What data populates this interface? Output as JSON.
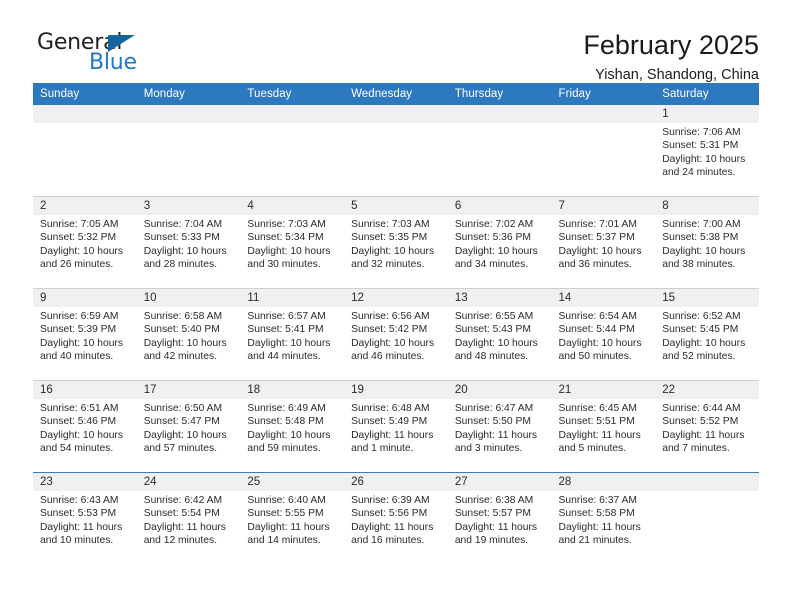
{
  "brand": {
    "name_top": "General",
    "name_bottom": "Blue",
    "accent_color": "#2179c4",
    "triangle_color": "#15659f"
  },
  "header": {
    "title": "February 2025",
    "subtitle": "Yishan, Shandong, China"
  },
  "calendar": {
    "header_bg": "#2c79c0",
    "daynum_bg": "#f0f0f0",
    "weekday_headers": [
      "Sunday",
      "Monday",
      "Tuesday",
      "Wednesday",
      "Thursday",
      "Friday",
      "Saturday"
    ],
    "weeks": [
      [
        {
          "day": "",
          "empty": true
        },
        {
          "day": "",
          "empty": true
        },
        {
          "day": "",
          "empty": true
        },
        {
          "day": "",
          "empty": true
        },
        {
          "day": "",
          "empty": true
        },
        {
          "day": "",
          "empty": true
        },
        {
          "day": "1",
          "sunrise": "Sunrise: 7:06 AM",
          "sunset": "Sunset: 5:31 PM",
          "daylight": "Daylight: 10 hours and 24 minutes."
        }
      ],
      [
        {
          "day": "2",
          "sunrise": "Sunrise: 7:05 AM",
          "sunset": "Sunset: 5:32 PM",
          "daylight": "Daylight: 10 hours and 26 minutes."
        },
        {
          "day": "3",
          "sunrise": "Sunrise: 7:04 AM",
          "sunset": "Sunset: 5:33 PM",
          "daylight": "Daylight: 10 hours and 28 minutes."
        },
        {
          "day": "4",
          "sunrise": "Sunrise: 7:03 AM",
          "sunset": "Sunset: 5:34 PM",
          "daylight": "Daylight: 10 hours and 30 minutes."
        },
        {
          "day": "5",
          "sunrise": "Sunrise: 7:03 AM",
          "sunset": "Sunset: 5:35 PM",
          "daylight": "Daylight: 10 hours and 32 minutes."
        },
        {
          "day": "6",
          "sunrise": "Sunrise: 7:02 AM",
          "sunset": "Sunset: 5:36 PM",
          "daylight": "Daylight: 10 hours and 34 minutes."
        },
        {
          "day": "7",
          "sunrise": "Sunrise: 7:01 AM",
          "sunset": "Sunset: 5:37 PM",
          "daylight": "Daylight: 10 hours and 36 minutes."
        },
        {
          "day": "8",
          "sunrise": "Sunrise: 7:00 AM",
          "sunset": "Sunset: 5:38 PM",
          "daylight": "Daylight: 10 hours and 38 minutes."
        }
      ],
      [
        {
          "day": "9",
          "sunrise": "Sunrise: 6:59 AM",
          "sunset": "Sunset: 5:39 PM",
          "daylight": "Daylight: 10 hours and 40 minutes."
        },
        {
          "day": "10",
          "sunrise": "Sunrise: 6:58 AM",
          "sunset": "Sunset: 5:40 PM",
          "daylight": "Daylight: 10 hours and 42 minutes."
        },
        {
          "day": "11",
          "sunrise": "Sunrise: 6:57 AM",
          "sunset": "Sunset: 5:41 PM",
          "daylight": "Daylight: 10 hours and 44 minutes."
        },
        {
          "day": "12",
          "sunrise": "Sunrise: 6:56 AM",
          "sunset": "Sunset: 5:42 PM",
          "daylight": "Daylight: 10 hours and 46 minutes."
        },
        {
          "day": "13",
          "sunrise": "Sunrise: 6:55 AM",
          "sunset": "Sunset: 5:43 PM",
          "daylight": "Daylight: 10 hours and 48 minutes."
        },
        {
          "day": "14",
          "sunrise": "Sunrise: 6:54 AM",
          "sunset": "Sunset: 5:44 PM",
          "daylight": "Daylight: 10 hours and 50 minutes."
        },
        {
          "day": "15",
          "sunrise": "Sunrise: 6:52 AM",
          "sunset": "Sunset: 5:45 PM",
          "daylight": "Daylight: 10 hours and 52 minutes."
        }
      ],
      [
        {
          "day": "16",
          "sunrise": "Sunrise: 6:51 AM",
          "sunset": "Sunset: 5:46 PM",
          "daylight": "Daylight: 10 hours and 54 minutes."
        },
        {
          "day": "17",
          "sunrise": "Sunrise: 6:50 AM",
          "sunset": "Sunset: 5:47 PM",
          "daylight": "Daylight: 10 hours and 57 minutes."
        },
        {
          "day": "18",
          "sunrise": "Sunrise: 6:49 AM",
          "sunset": "Sunset: 5:48 PM",
          "daylight": "Daylight: 10 hours and 59 minutes."
        },
        {
          "day": "19",
          "sunrise": "Sunrise: 6:48 AM",
          "sunset": "Sunset: 5:49 PM",
          "daylight": "Daylight: 11 hours and 1 minute."
        },
        {
          "day": "20",
          "sunrise": "Sunrise: 6:47 AM",
          "sunset": "Sunset: 5:50 PM",
          "daylight": "Daylight: 11 hours and 3 minutes."
        },
        {
          "day": "21",
          "sunrise": "Sunrise: 6:45 AM",
          "sunset": "Sunset: 5:51 PM",
          "daylight": "Daylight: 11 hours and 5 minutes."
        },
        {
          "day": "22",
          "sunrise": "Sunrise: 6:44 AM",
          "sunset": "Sunset: 5:52 PM",
          "daylight": "Daylight: 11 hours and 7 minutes."
        }
      ],
      [
        {
          "day": "23",
          "sunrise": "Sunrise: 6:43 AM",
          "sunset": "Sunset: 5:53 PM",
          "daylight": "Daylight: 11 hours and 10 minutes."
        },
        {
          "day": "24",
          "sunrise": "Sunrise: 6:42 AM",
          "sunset": "Sunset: 5:54 PM",
          "daylight": "Daylight: 11 hours and 12 minutes."
        },
        {
          "day": "25",
          "sunrise": "Sunrise: 6:40 AM",
          "sunset": "Sunset: 5:55 PM",
          "daylight": "Daylight: 11 hours and 14 minutes."
        },
        {
          "day": "26",
          "sunrise": "Sunrise: 6:39 AM",
          "sunset": "Sunset: 5:56 PM",
          "daylight": "Daylight: 11 hours and 16 minutes."
        },
        {
          "day": "27",
          "sunrise": "Sunrise: 6:38 AM",
          "sunset": "Sunset: 5:57 PM",
          "daylight": "Daylight: 11 hours and 19 minutes."
        },
        {
          "day": "28",
          "sunrise": "Sunrise: 6:37 AM",
          "sunset": "Sunset: 5:58 PM",
          "daylight": "Daylight: 11 hours and 21 minutes."
        },
        {
          "day": "",
          "empty": true
        }
      ]
    ]
  }
}
